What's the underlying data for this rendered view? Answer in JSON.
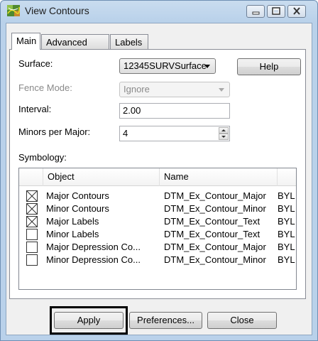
{
  "window": {
    "title": "View Contours"
  },
  "tabs": [
    {
      "label": "Main"
    },
    {
      "label": "Advanced"
    },
    {
      "label": "Labels"
    }
  ],
  "main": {
    "surface": {
      "label": "Surface:",
      "value": "12345SURVSurface"
    },
    "help_label": "Help",
    "fence_mode": {
      "label": "Fence Mode:",
      "value": "Ignore"
    },
    "interval": {
      "label": "Interval:",
      "value": "2.00"
    },
    "minors_per_major": {
      "label": "Minors per Major:",
      "value": "4"
    },
    "symbology": {
      "label": "Symbology:",
      "columns": [
        "Object",
        "Name",
        ""
      ],
      "rows": [
        {
          "object": "Major Contours",
          "name": "DTM_Ex_Contour_Major",
          "extra": "BYL",
          "checked": true
        },
        {
          "object": "Minor Contours",
          "name": "DTM_Ex_Contour_Minor",
          "extra": "BYL",
          "checked": true
        },
        {
          "object": "Major Labels",
          "name": "DTM_Ex_Contour_Text",
          "extra": "BYL",
          "checked": true
        },
        {
          "object": "Minor Labels",
          "name": "DTM_Ex_Contour_Text",
          "extra": "BYL",
          "checked": false
        },
        {
          "object": "Major Depression Co...",
          "name": "DTM_Ex_Contour_Major",
          "extra": "BYL",
          "checked": false
        },
        {
          "object": "Minor Depression Co...",
          "name": "DTM_Ex_Contour_Minor",
          "extra": "BYL",
          "checked": false
        }
      ]
    }
  },
  "footer": {
    "apply_label": "Apply",
    "preferences_label": "Preferences...",
    "close_label": "Close"
  },
  "icons": {
    "app": "contour-map-icon",
    "minimize": "minimize-icon",
    "maximize": "maximize-icon",
    "close": "close-icon",
    "dropdown": "chevron-down-icon",
    "spin_up": "spin-up-icon",
    "spin_down": "spin-down-icon",
    "checked": "checkbox-x-icon"
  },
  "colors": {
    "titlebar": "#b9d1ea",
    "dialog_bg": "#f0f0f0",
    "highlight_outline": "#000000"
  }
}
